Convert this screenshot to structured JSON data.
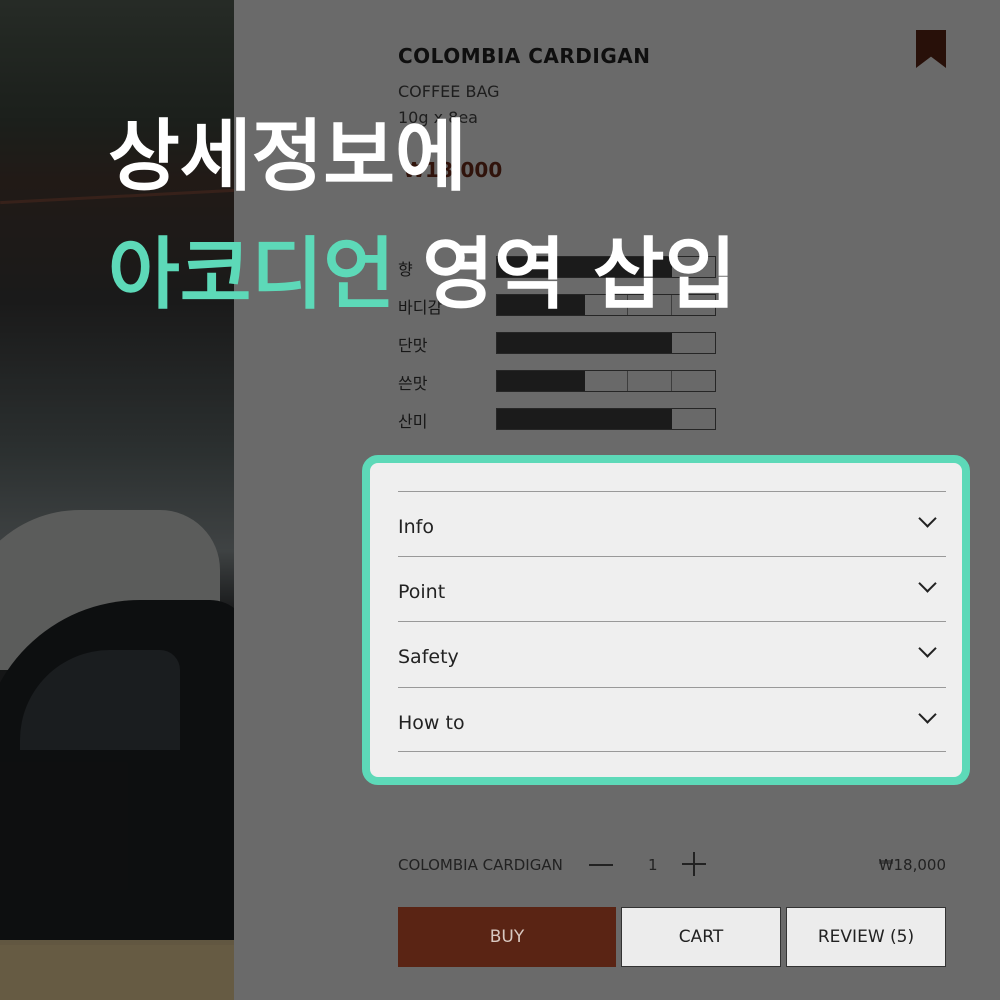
{
  "product": {
    "title": "COLOMBIA CARDIGAN",
    "subtitle": "COFFEE BAG",
    "weight": "10g x 8ea",
    "price": "₩18,000"
  },
  "ratings": [
    {
      "label": "향",
      "level": 4,
      "max": 5
    },
    {
      "label": "바디감",
      "level": 2,
      "max": 5
    },
    {
      "label": "단맛",
      "level": 4,
      "max": 5
    },
    {
      "label": "쓴맛",
      "level": 2,
      "max": 5
    },
    {
      "label": "산미",
      "level": 4,
      "max": 5
    }
  ],
  "accordion": {
    "items": [
      {
        "label": "Info"
      },
      {
        "label": "Point"
      },
      {
        "label": "Safety"
      },
      {
        "label": "How to"
      }
    ]
  },
  "order": {
    "name": "COLOMBIA CARDIGAN",
    "quantity": "1",
    "price": "₩18,000"
  },
  "buttons": {
    "buy": "BUY",
    "cart": "CART",
    "review": "REVIEW (5)"
  },
  "overlay": {
    "line1": "상세정보에",
    "line2_accent": "아코디언",
    "line2_rest": "영역 삽입"
  },
  "colors": {
    "accent": "#5dd9b8",
    "brand": "#5a2414"
  },
  "icons": {
    "bookmark": "bookmark-icon",
    "chevron": "chevron-down-icon",
    "minus": "minus-icon",
    "plus": "plus-icon"
  }
}
